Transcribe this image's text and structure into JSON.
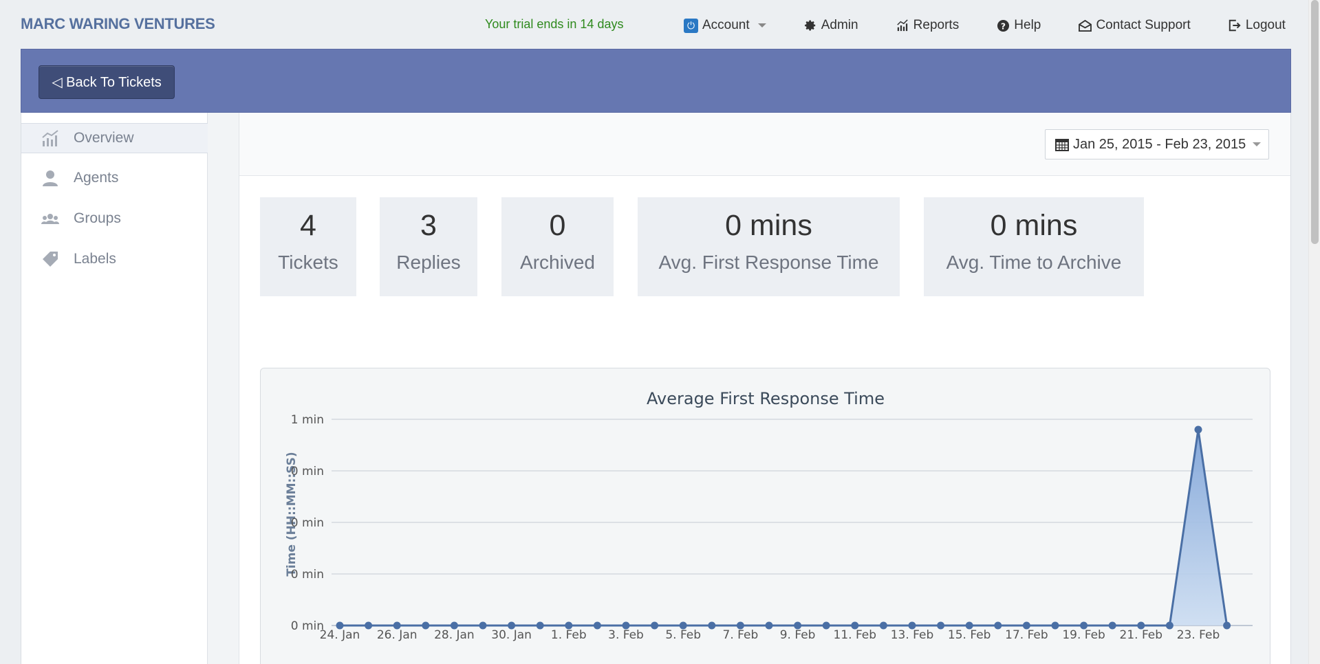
{
  "brand": "MARC WARING VENTURES",
  "trial_notice": "Your trial ends in 14 days",
  "topnav": {
    "account": "Account",
    "admin": "Admin",
    "reports": "Reports",
    "help": "Help",
    "contact": "Contact Support",
    "logout": "Logout"
  },
  "back_button": "◁ Back To Tickets",
  "sidebar": {
    "items": [
      {
        "label": "Overview",
        "icon": "chart-icon"
      },
      {
        "label": "Agents",
        "icon": "user-icon"
      },
      {
        "label": "Groups",
        "icon": "group-icon"
      },
      {
        "label": "Labels",
        "icon": "tag-icon"
      }
    ]
  },
  "date_range": "Jan 25, 2015 - Feb 23, 2015",
  "stats": [
    {
      "value": "4",
      "label": "Tickets"
    },
    {
      "value": "3",
      "label": "Replies"
    },
    {
      "value": "0",
      "label": "Archived"
    },
    {
      "value": "0 mins",
      "label": "Avg. First Response Time"
    },
    {
      "value": "0 mins",
      "label": "Avg. Time to Archive"
    }
  ],
  "colors": {
    "accent_band": "#6677b1",
    "series": "#4a6fa5",
    "trial_text": "#2f8a1e"
  },
  "chart_data": {
    "type": "area",
    "title": "Average First Response Time",
    "ylabel": "Time (HH::MM::SS)",
    "xlabel": "",
    "y_tick_labels": [
      "1 min",
      "0 min",
      "0 min",
      "0 min",
      "0 min"
    ],
    "x_tick_labels": [
      "24. Jan",
      "26. Jan",
      "28. Jan",
      "30. Jan",
      "1. Feb",
      "3. Feb",
      "5. Feb",
      "7. Feb",
      "9. Feb",
      "11. Feb",
      "13. Feb",
      "15. Feb",
      "17. Feb",
      "19. Feb",
      "21. Feb",
      "23. Feb"
    ],
    "x": [
      "2015-01-24",
      "2015-01-25",
      "2015-01-26",
      "2015-01-27",
      "2015-01-28",
      "2015-01-29",
      "2015-01-30",
      "2015-01-31",
      "2015-02-01",
      "2015-02-02",
      "2015-02-03",
      "2015-02-04",
      "2015-02-05",
      "2015-02-06",
      "2015-02-07",
      "2015-02-08",
      "2015-02-09",
      "2015-02-10",
      "2015-02-11",
      "2015-02-12",
      "2015-02-13",
      "2015-02-14",
      "2015-02-15",
      "2015-02-16",
      "2015-02-17",
      "2015-02-18",
      "2015-02-19",
      "2015-02-20",
      "2015-02-21",
      "2015-02-22",
      "2015-02-23",
      "2015-02-24"
    ],
    "values_minutes": [
      0,
      0,
      0,
      0,
      0,
      0,
      0,
      0,
      0,
      0,
      0,
      0,
      0,
      0,
      0,
      0,
      0,
      0,
      0,
      0,
      0,
      0,
      0,
      0,
      0,
      0,
      0,
      0,
      0,
      0,
      0.95,
      0
    ],
    "ylim": [
      0,
      1
    ],
    "grid": true,
    "legend": "none"
  }
}
